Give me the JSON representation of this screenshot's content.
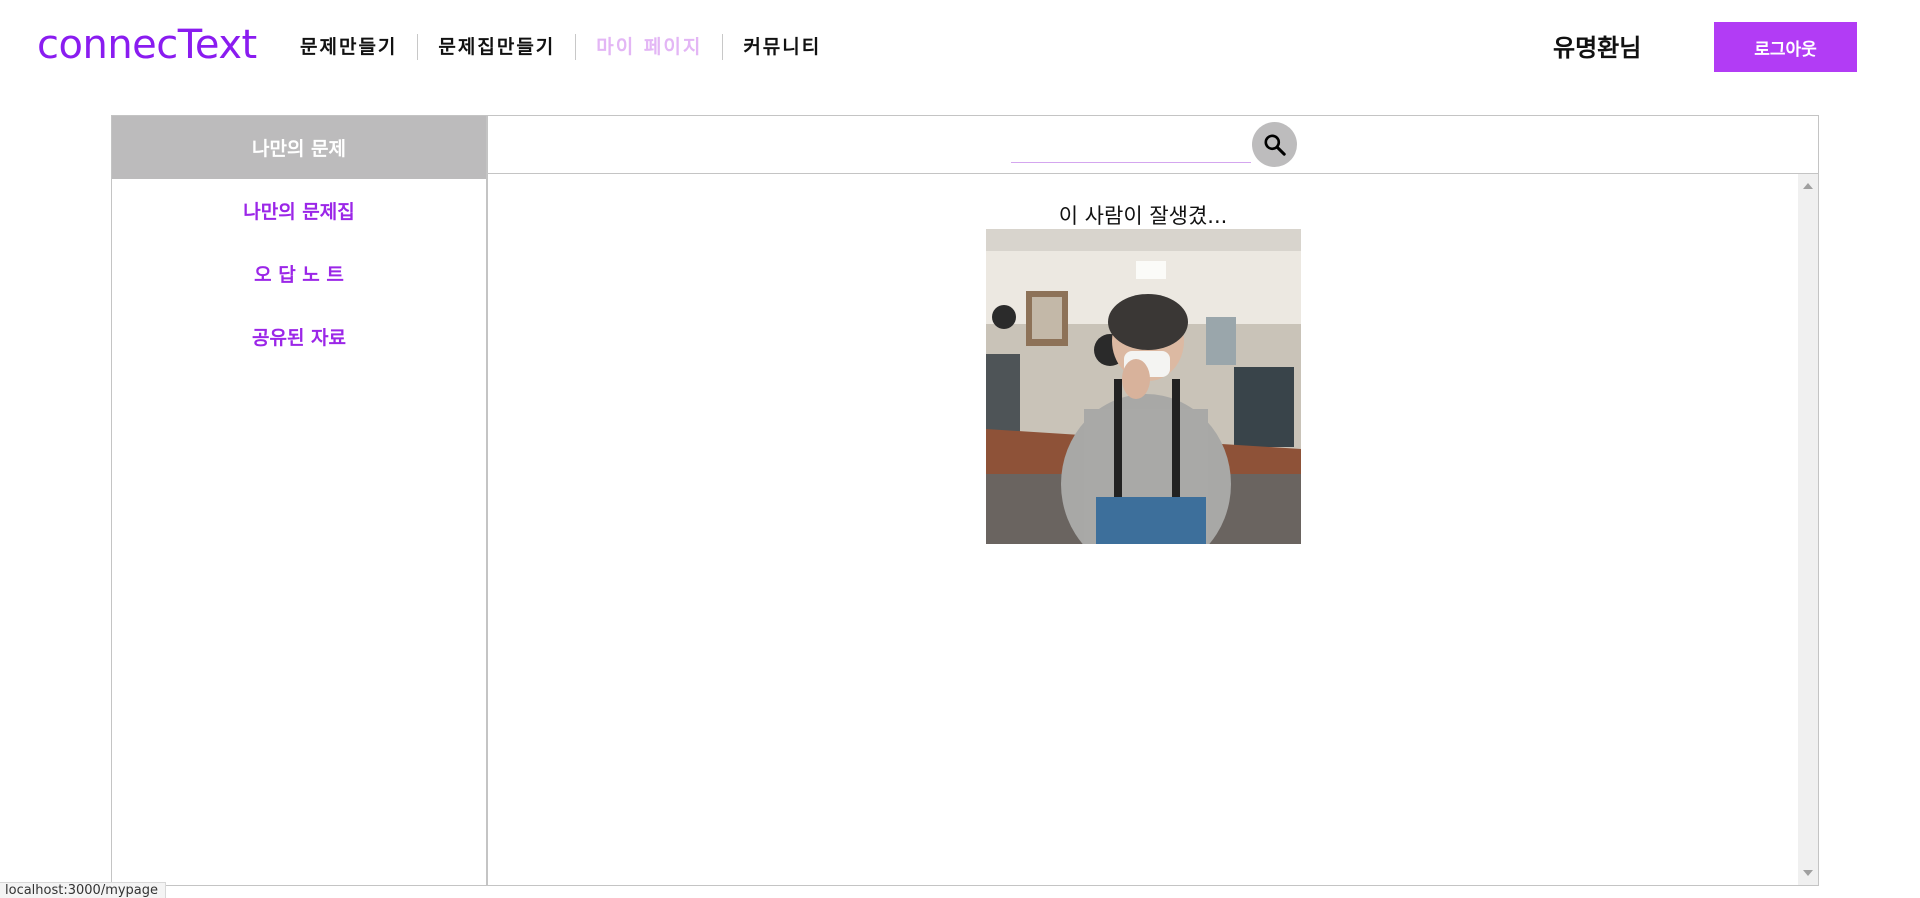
{
  "header": {
    "logo": "connecText",
    "nav": [
      {
        "label": "문제만들기",
        "active": false
      },
      {
        "label": "문제집만들기",
        "active": false
      },
      {
        "label": "마이 페이지",
        "active": true
      },
      {
        "label": "커뮤니티",
        "active": false
      }
    ],
    "user_name": "유명환님",
    "logout_label": "로그아웃"
  },
  "sidebar": {
    "items": [
      {
        "label": "나만의 문제",
        "active": true
      },
      {
        "label": "나만의 문제집",
        "active": false
      },
      {
        "label": "오 답 노 트",
        "active": false
      },
      {
        "label": "공유된 자료",
        "active": false
      }
    ]
  },
  "search": {
    "value": "",
    "placeholder": "",
    "button_icon": "search-icon"
  },
  "post": {
    "title": "이 사람이 잘생겼...",
    "image_alt": "사진"
  },
  "status_bar": {
    "url": "localhost:3000/mypage"
  },
  "colors": {
    "brand": "#8a1cf0",
    "button": "#b23cf5",
    "active_nav": "#e3b6f5",
    "sidebar_link": "#9b26e8",
    "sidebar_active_bg": "#bcbbbc"
  }
}
